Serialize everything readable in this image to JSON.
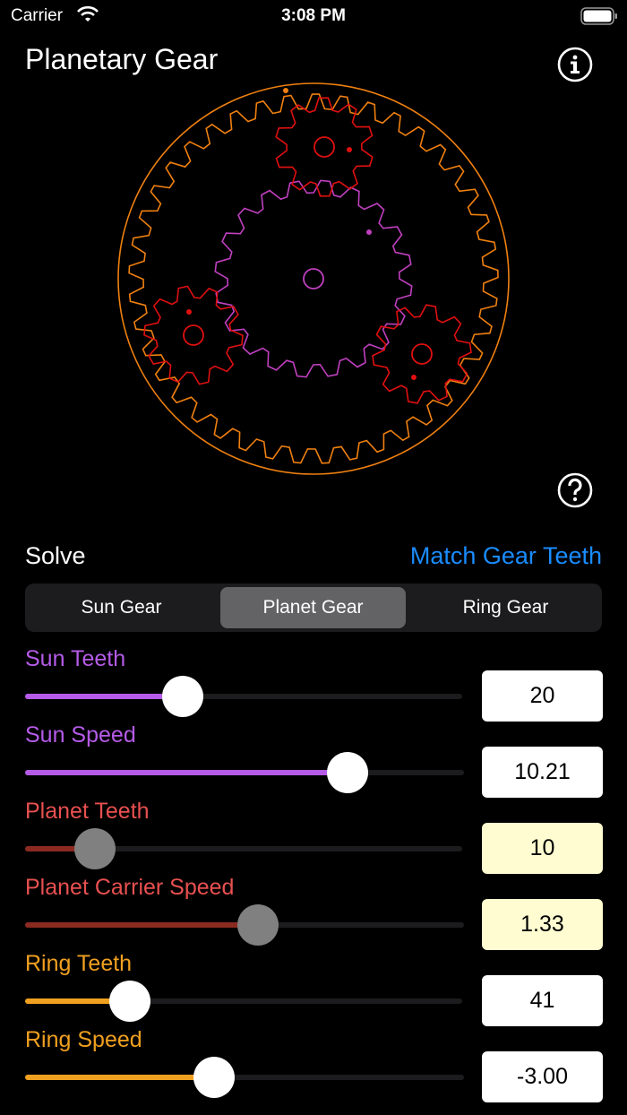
{
  "status_bar": {
    "carrier": "Carrier",
    "time": "3:08 PM"
  },
  "title": "Planetary Gear",
  "icons": {
    "info": "info-circle-icon",
    "help": "question-circle-icon",
    "wifi": "wifi-icon",
    "battery": "battery-icon"
  },
  "colors": {
    "sun": "#c040c0",
    "planet": "#e01010",
    "ring": "#f08010",
    "accent": "#1a8cff",
    "sun_label": "#b55be8",
    "planet_label": "#e85050",
    "ring_label": "#f0a020",
    "planet_fill": "#8a2a20",
    "locked_bg": "#fefcd0"
  },
  "solve": {
    "label": "Solve",
    "match_button": "Match Gear Teeth"
  },
  "segments": {
    "items": [
      "Sun Gear",
      "Planet Gear",
      "Ring Gear"
    ],
    "selected": "Planet Gear"
  },
  "controls": [
    {
      "label": "Sun Teeth",
      "value": "20",
      "fraction": 0.36
    },
    {
      "label": "Sun Speed",
      "value": "10.21",
      "fraction": 0.735
    },
    {
      "label": "Planet Teeth",
      "value": "10",
      "fraction": 0.16
    },
    {
      "label": "Planet Carrier Speed",
      "value": "1.33",
      "fraction": 0.53
    },
    {
      "label": "Ring Teeth",
      "value": "41",
      "fraction": 0.24
    },
    {
      "label": "Ring Speed",
      "value": "-3.00",
      "fraction": 0.43
    }
  ],
  "gears": {
    "sun_teeth": 20,
    "planet_teeth": 10,
    "ring_teeth": 41
  }
}
